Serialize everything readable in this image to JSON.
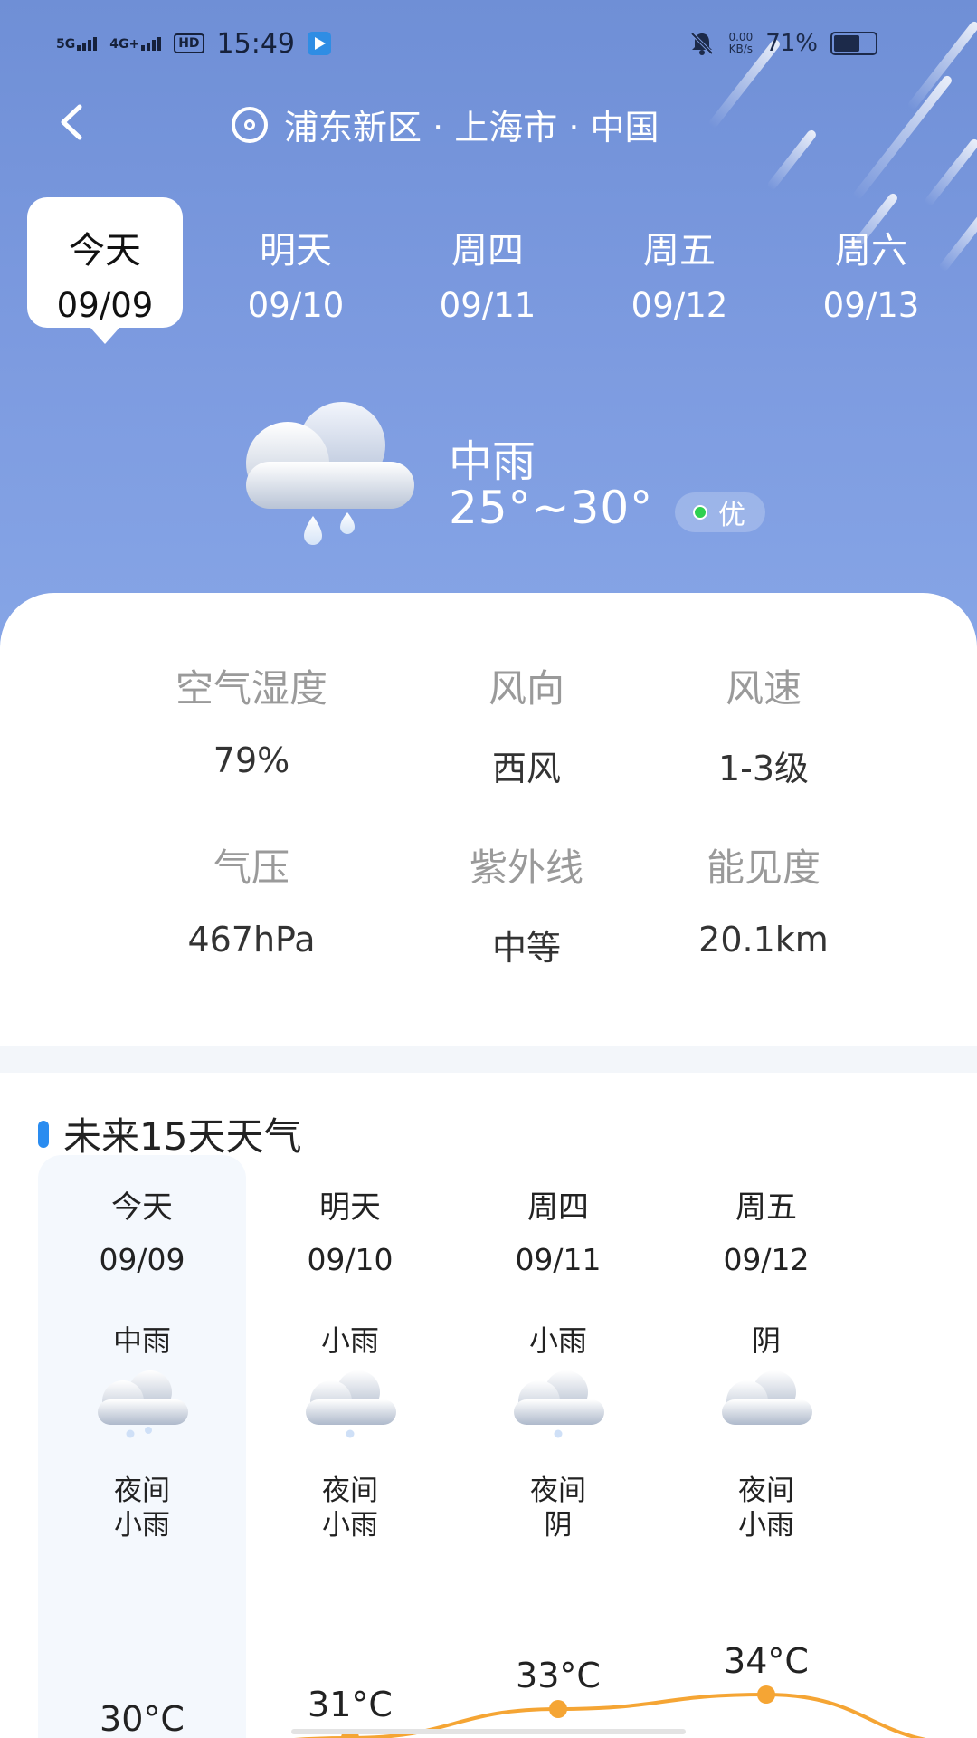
{
  "status": {
    "time": "15:49",
    "net1": "5G",
    "net2": "4G+",
    "hd": "HD",
    "speed_top": "0.00",
    "speed_bottom": "KB/s",
    "battery": "71%",
    "battery_level": 0.71
  },
  "location": "浦东新区 · 上海市 · 中国",
  "days": [
    {
      "name": "今天",
      "date": "09/09"
    },
    {
      "name": "明天",
      "date": "09/10"
    },
    {
      "name": "周四",
      "date": "09/11"
    },
    {
      "name": "周五",
      "date": "09/12"
    },
    {
      "name": "周六",
      "date": "09/13"
    }
  ],
  "current": {
    "condition": "中雨",
    "temp_range": "25°~30°",
    "aqi": "优",
    "icon": "cloud-rain-icon"
  },
  "details": [
    {
      "label": "空气湿度",
      "value": "79%"
    },
    {
      "label": "风向",
      "value": "西风"
    },
    {
      "label": "风速",
      "value": "1-3级"
    },
    {
      "label": "气压",
      "value": "467hPa"
    },
    {
      "label": "紫外线",
      "value": "中等"
    },
    {
      "label": "能见度",
      "value": "20.1km"
    }
  ],
  "forecast": {
    "title": "未来15天天气",
    "items": [
      {
        "name": "今天",
        "date": "09/09",
        "cond": "中雨",
        "night": "夜间\n小雨",
        "high": "30°C",
        "high_value": 30,
        "drops": 2
      },
      {
        "name": "明天",
        "date": "09/10",
        "cond": "小雨",
        "night": "夜间\n小雨",
        "high": "31°C",
        "high_value": 31,
        "drops": 1
      },
      {
        "name": "周四",
        "date": "09/11",
        "cond": "小雨",
        "night": "夜间\n阴",
        "high": "33°C",
        "high_value": 33,
        "drops": 1
      },
      {
        "name": "周五",
        "date": "09/12",
        "cond": "阴",
        "night": "夜间\n小雨",
        "high": "34°C",
        "high_value": 34,
        "drops": 0
      }
    ]
  },
  "colors": {
    "accent": "#2a8cf0",
    "curve": "#f5a534",
    "aqi_dot": "#2ed04f"
  }
}
